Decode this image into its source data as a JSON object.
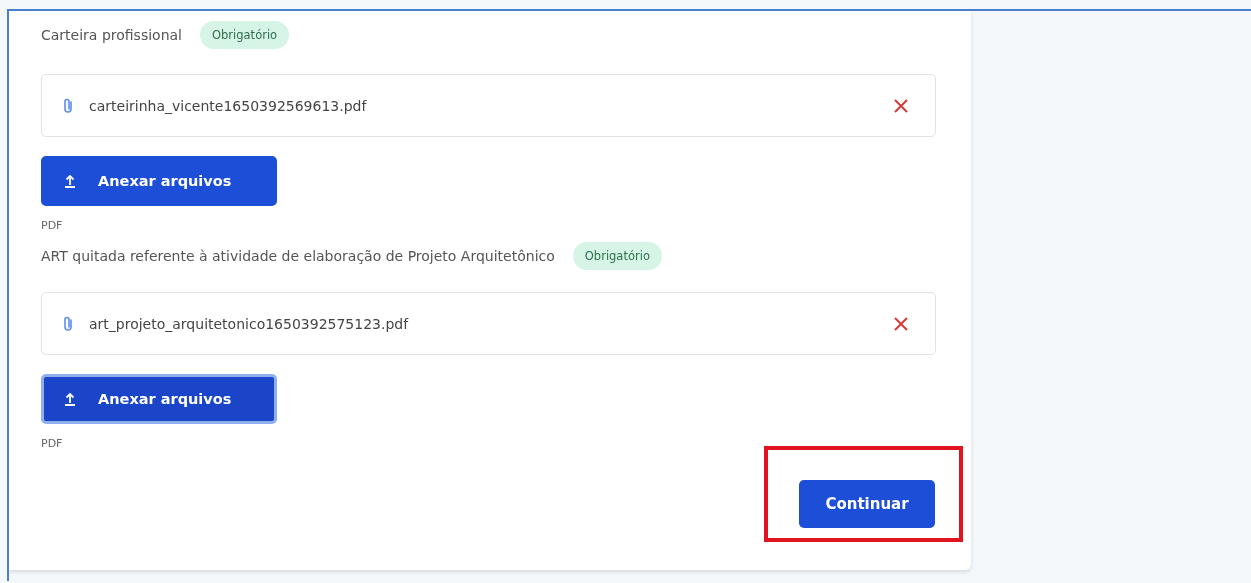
{
  "documents": [
    {
      "label": "Carteira profissional",
      "badge": "Obrigatório",
      "files": [
        {
          "name": "carteirinha_vicente1650392569613.pdf"
        }
      ],
      "upload_button": {
        "label": "Anexar arquivos",
        "focused": false
      },
      "hint": "PDF"
    },
    {
      "label": "ART quitada referente à atividade de elaboração de Projeto Arquitetônico",
      "badge": "Obrigatório",
      "files": [
        {
          "name": "art_projeto_arquitetonico1650392575123.pdf"
        }
      ],
      "upload_button": {
        "label": "Anexar arquivos",
        "focused": true
      },
      "hint": "PDF"
    }
  ],
  "continue_button": {
    "label": "Continuar",
    "highlighted": true
  }
}
